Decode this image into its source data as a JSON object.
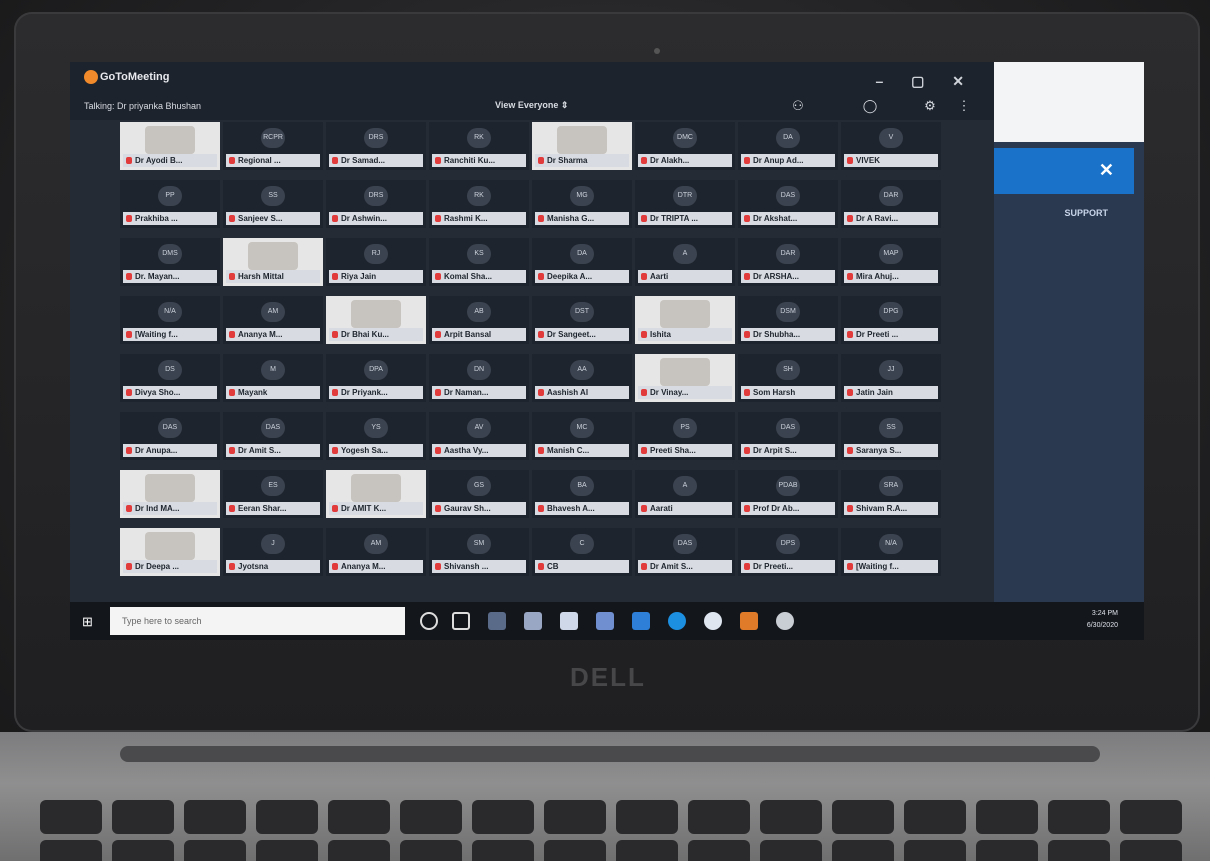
{
  "meeting": {
    "app_title": "GoToMeeting",
    "talking": "Talking: Dr priyanka Bhushan",
    "view_selector": "View Everyone",
    "window_controls": "– ▢ ✕"
  },
  "participants": [
    {
      "initials": "",
      "name": "Dr Ayodi B...",
      "video": true
    },
    {
      "initials": "RCPR",
      "name": "Regional ..."
    },
    {
      "initials": "DRS",
      "name": "Dr Samad..."
    },
    {
      "initials": "RK",
      "name": "Ranchiti Ku..."
    },
    {
      "initials": "",
      "name": "Dr Sharma",
      "video": true
    },
    {
      "initials": "DMC",
      "name": "Dr Alakh..."
    },
    {
      "initials": "DA",
      "name": "Dr Anup Ad..."
    },
    {
      "initials": "V",
      "name": "VIVEK"
    },
    {
      "initials": "PP",
      "name": "Prakhiba ..."
    },
    {
      "initials": "SS",
      "name": "Sanjeev S..."
    },
    {
      "initials": "DRS",
      "name": "Dr Ashwin..."
    },
    {
      "initials": "RK",
      "name": "Rashmi K..."
    },
    {
      "initials": "MG",
      "name": "Manisha G..."
    },
    {
      "initials": "DTR",
      "name": "Dr TRIPTA ..."
    },
    {
      "initials": "DAS",
      "name": "Dr Akshat..."
    },
    {
      "initials": "DAR",
      "name": "Dr A Ravi..."
    },
    {
      "initials": "DMS",
      "name": "Dr. Mayan..."
    },
    {
      "initials": "",
      "name": "Harsh Mittal",
      "video": true
    },
    {
      "initials": "RJ",
      "name": "Riya Jain"
    },
    {
      "initials": "KS",
      "name": "Komal Sha..."
    },
    {
      "initials": "DA",
      "name": "Deepika A..."
    },
    {
      "initials": "A",
      "name": "Aarti"
    },
    {
      "initials": "DAR",
      "name": "Dr ARSHA..."
    },
    {
      "initials": "MAP",
      "name": "Mira Ahuj..."
    },
    {
      "initials": "N/A",
      "name": "[Waiting f..."
    },
    {
      "initials": "AM",
      "name": "Ananya M..."
    },
    {
      "initials": "",
      "name": "Dr Bhai Ku...",
      "video": true
    },
    {
      "initials": "AB",
      "name": "Arpit Bansal"
    },
    {
      "initials": "DST",
      "name": "Dr Sangeet..."
    },
    {
      "initials": "",
      "name": "Ishita",
      "video": true
    },
    {
      "initials": "DSM",
      "name": "Dr Shubha..."
    },
    {
      "initials": "DPG",
      "name": "Dr Preeti ..."
    },
    {
      "initials": "DS",
      "name": "Divya Sho..."
    },
    {
      "initials": "M",
      "name": "Mayank"
    },
    {
      "initials": "DPA",
      "name": "Dr Priyank..."
    },
    {
      "initials": "DN",
      "name": "Dr Naman..."
    },
    {
      "initials": "AA",
      "name": "Aashish Al"
    },
    {
      "initials": "",
      "name": "Dr Vinay...",
      "video": true
    },
    {
      "initials": "SH",
      "name": "Som Harsh"
    },
    {
      "initials": "JJ",
      "name": "Jatin Jain"
    },
    {
      "initials": "DAS",
      "name": "Dr Anupa..."
    },
    {
      "initials": "DAS",
      "name": "Dr Amit S..."
    },
    {
      "initials": "YS",
      "name": "Yogesh Sa..."
    },
    {
      "initials": "AV",
      "name": "Aastha Vy..."
    },
    {
      "initials": "MC",
      "name": "Manish C..."
    },
    {
      "initials": "PS",
      "name": "Preeti Sha..."
    },
    {
      "initials": "DAS",
      "name": "Dr Arpit S..."
    },
    {
      "initials": "SS",
      "name": "Saranya S..."
    },
    {
      "initials": "",
      "name": "Dr Ind MA...",
      "video": true
    },
    {
      "initials": "ES",
      "name": "Eeran Shar..."
    },
    {
      "initials": "",
      "name": "Dr AMIT K...",
      "video": true
    },
    {
      "initials": "GS",
      "name": "Gaurav Sh..."
    },
    {
      "initials": "BA",
      "name": "Bhavesh A..."
    },
    {
      "initials": "A",
      "name": "Aarati"
    },
    {
      "initials": "PDAB",
      "name": "Prof Dr Ab..."
    },
    {
      "initials": "SRA",
      "name": "Shivam R.A..."
    },
    {
      "initials": "",
      "name": "Dr Deepa ...",
      "video": true
    },
    {
      "initials": "J",
      "name": "Jyotsna"
    },
    {
      "initials": "AM",
      "name": "Ananya M..."
    },
    {
      "initials": "SM",
      "name": "Shivansh ..."
    },
    {
      "initials": "C",
      "name": "CB"
    },
    {
      "initials": "DAS",
      "name": "Dr Amit S..."
    },
    {
      "initials": "DPS",
      "name": "Dr Preeti..."
    },
    {
      "initials": "N/A",
      "name": "[Waiting f..."
    }
  ],
  "side_panel": {
    "close": "✕",
    "support_label": "SUPPORT"
  },
  "taskbar": {
    "search_placeholder": "Type here to search",
    "time": "3:24 PM",
    "date": "6/30/2020"
  },
  "brand": "DELL"
}
